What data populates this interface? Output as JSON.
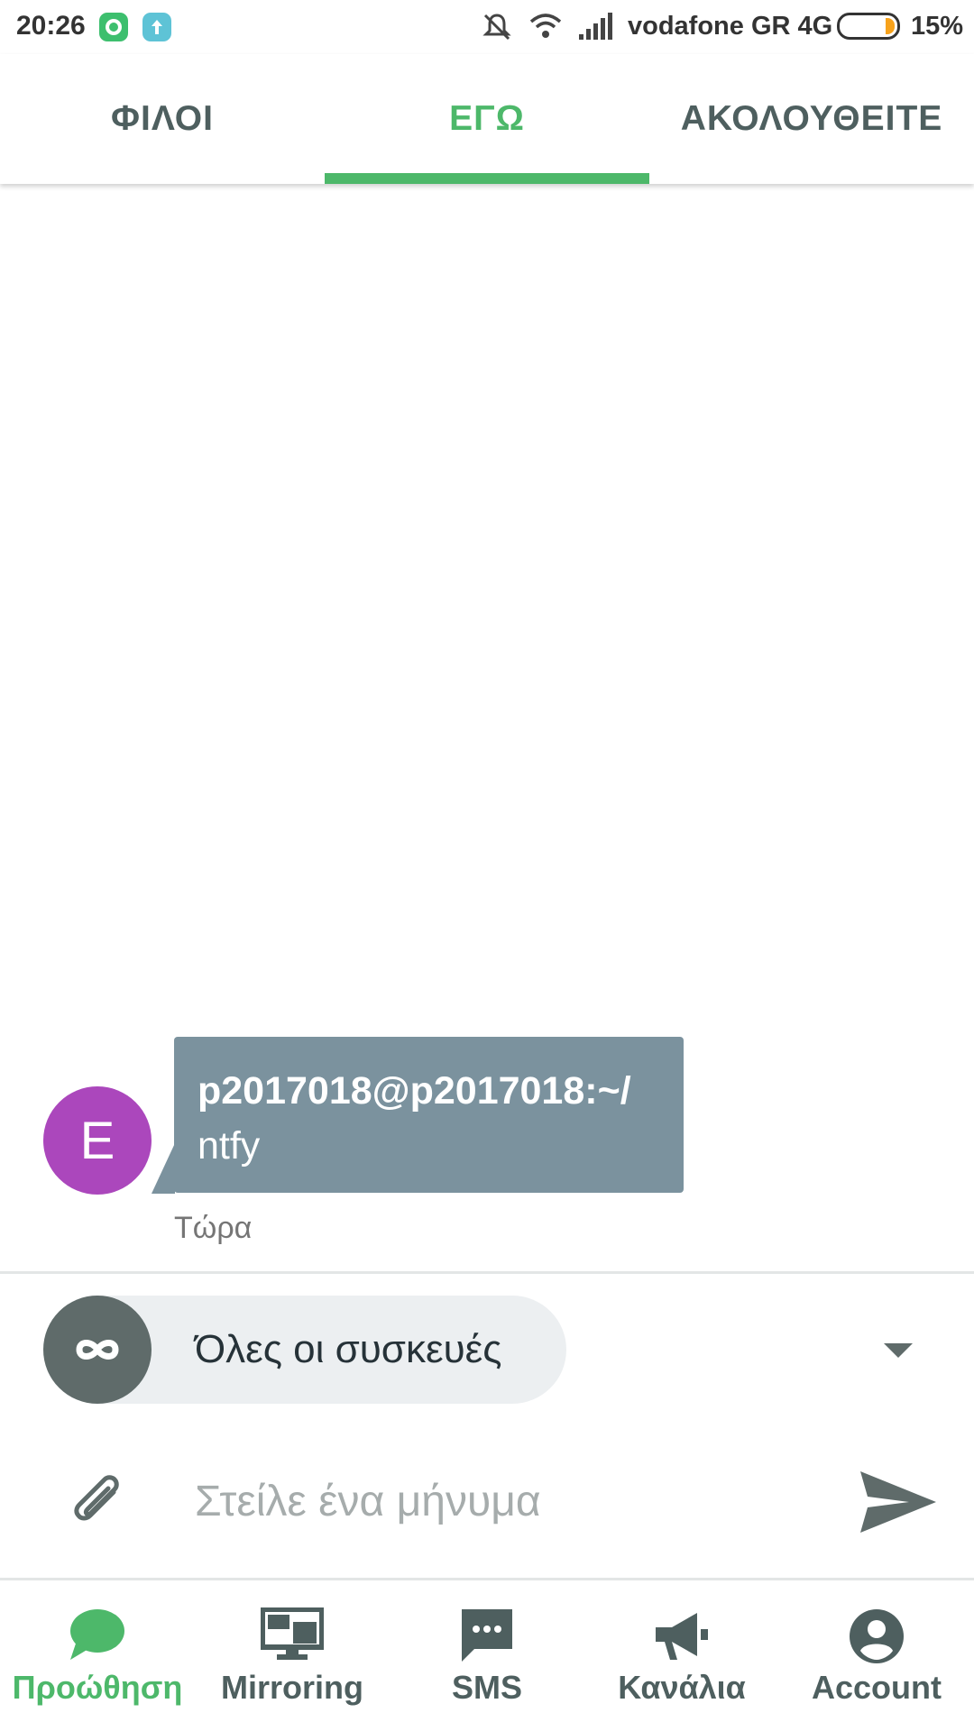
{
  "status_bar": {
    "time": "20:26",
    "carrier": "vodafone GR 4G",
    "battery_percent": "15%",
    "battery_level": 0.15,
    "icons": [
      "notification-app-icon",
      "upload-icon",
      "mute-icon",
      "wifi-icon",
      "signal-icon",
      "battery-icon"
    ]
  },
  "tabs": [
    {
      "label": "ΦΙΛΟΙ",
      "active": false
    },
    {
      "label": "ΕΓΩ",
      "active": true
    },
    {
      "label": "ΑΚΟΛΟΥΘΕΙΤΕ",
      "active": false
    }
  ],
  "message": {
    "avatar_letter": "E",
    "title": "p2017018@p2017018:~/",
    "body": "ntfy",
    "time": "Τώρα"
  },
  "device_selector": {
    "label": "Όλες οι συσκευές",
    "icon": "infinity-icon"
  },
  "compose": {
    "placeholder": "Στείλε ένα μήνυμα",
    "value": ""
  },
  "bottom_nav": [
    {
      "label": "Προώθηση",
      "icon": "chat-bubble-icon",
      "active": true
    },
    {
      "label": "Mirroring",
      "icon": "monitor-icon",
      "active": false
    },
    {
      "label": "SMS",
      "icon": "sms-icon",
      "active": false
    },
    {
      "label": "Κανάλια",
      "icon": "megaphone-icon",
      "active": false
    },
    {
      "label": "Account",
      "icon": "account-icon",
      "active": false
    }
  ],
  "colors": {
    "accent": "#4db86a",
    "avatar": "#ab47bc",
    "bubble": "#7b929e",
    "icon_gray": "#5f6b6a"
  }
}
